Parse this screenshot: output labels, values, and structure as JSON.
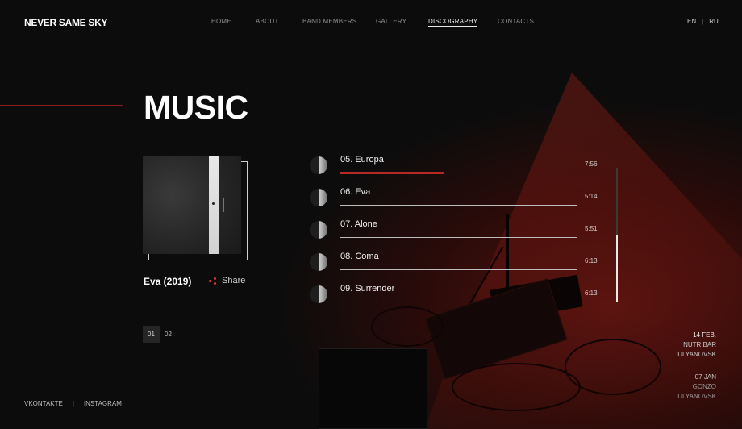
{
  "brand": {
    "logo": "NEVER SAME SKY"
  },
  "nav": {
    "items": [
      {
        "label": "HOME",
        "active": false
      },
      {
        "label": "ABOUT",
        "active": false
      },
      {
        "label": "BAND MEMBERS",
        "active": false
      },
      {
        "label": "GALLERY",
        "active": false
      },
      {
        "label": "DISCOGRAPHY",
        "active": true
      },
      {
        "label": "CONTACTS",
        "active": false
      }
    ]
  },
  "lang": {
    "en": "EN",
    "ru": "RU"
  },
  "page": {
    "title": "MUSIC"
  },
  "album": {
    "title": "Eva (2019)",
    "share_label": "Share"
  },
  "pager": {
    "pages": [
      "01",
      "02"
    ],
    "current": "01"
  },
  "tracks": [
    {
      "name": "05. Europa",
      "duration": "7:56",
      "progress": 0.44
    },
    {
      "name": "06. Eva",
      "duration": "5:14"
    },
    {
      "name": "07. Alone",
      "duration": "5:51"
    },
    {
      "name": "08. Coma",
      "duration": "6:13"
    },
    {
      "name": "09. Surrender",
      "duration": "6:13"
    }
  ],
  "events": [
    {
      "date": "14 FEB.",
      "venue": "NUTR BAR",
      "city": "ULYANOVSK"
    },
    {
      "date": "07 JAN",
      "venue": "GONZO",
      "city": "ULYANOVSK"
    }
  ],
  "social": {
    "vk": "VKONTAKTE",
    "instagram": "INSTAGRAM"
  },
  "colors": {
    "accent": "#b52a24",
    "background": "#0c0c0c"
  }
}
